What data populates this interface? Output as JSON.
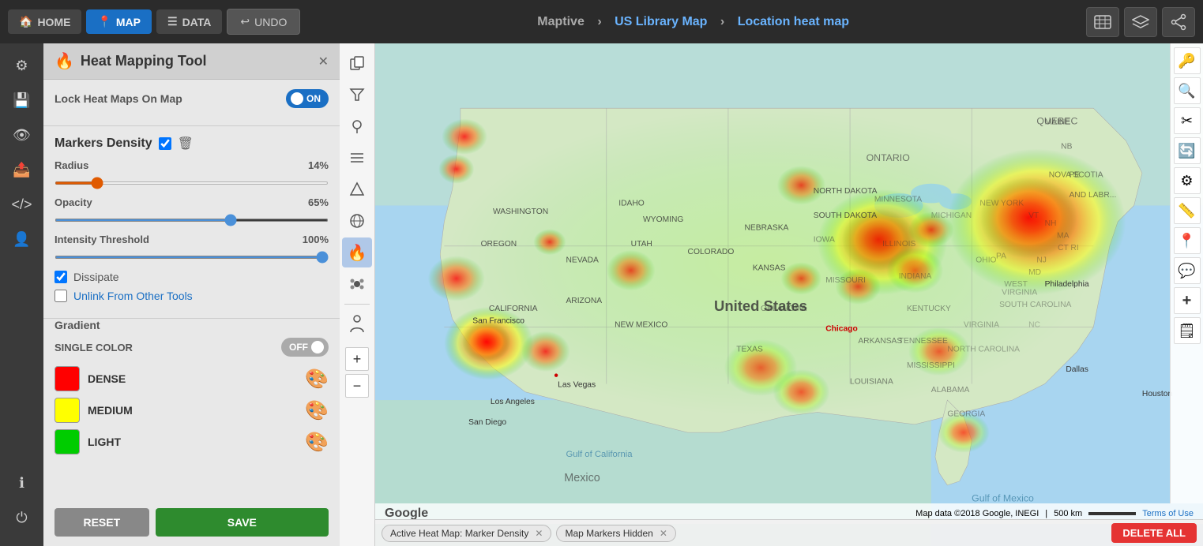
{
  "nav": {
    "home_label": "HOME",
    "map_label": "MAP",
    "data_label": "DATA",
    "undo_label": "UNDO",
    "breadcrumb_brand": "Maptive",
    "breadcrumb_map": "US Library Map",
    "breadcrumb_layer": "Location heat map",
    "map_icon_tooltip": "Map style",
    "layers_icon_tooltip": "Layers",
    "share_icon_tooltip": "Share"
  },
  "left_sidebar": {
    "icons": [
      "⚙",
      "💾",
      "👁",
      "📤",
      "</>",
      "👤",
      "ℹ",
      "⏻"
    ]
  },
  "tool_panel": {
    "title": "Heat Mapping Tool",
    "lock_label": "Lock Heat Maps On Map",
    "toggle_state": "ON",
    "markers_density_label": "Markers Density",
    "radius_label": "Radius",
    "radius_value": "14%",
    "opacity_label": "Opacity",
    "opacity_value": "65%",
    "intensity_label": "Intensity Threshold",
    "intensity_value": "100%",
    "dissipate_label": "Dissipate",
    "unlink_label": "Unlink From Other Tools",
    "gradient_title": "Gradient",
    "single_color_label": "SINGLE COLOR",
    "toggle_off_state": "OFF",
    "dense_label": "DENSE",
    "medium_label": "MEDIUM",
    "light_label": "LIGHT",
    "dense_color": "#ff0000",
    "medium_color": "#ffff00",
    "light_color": "#00cc00",
    "reset_label": "RESET",
    "save_label": "SAVE"
  },
  "map_toolbar": {
    "icons": [
      "copy",
      "filter",
      "pin",
      "layers",
      "shape",
      "globe",
      "fire",
      "cluster"
    ]
  },
  "map": {
    "bottom_left": "Google",
    "map_data": "Map data ©2018 Google, INEGI",
    "scale": "500 km",
    "terms": "Terms of Use"
  },
  "status_bar": {
    "badge1": "Active Heat Map: Marker Density",
    "badge2": "Map Markers Hidden",
    "delete_all": "DELETE ALL"
  },
  "right_sidebar": {
    "icons": [
      "🔑",
      "🔍",
      "✂",
      "🔄",
      "⚙",
      "📏",
      "📍",
      "💬",
      "➕",
      "🗒"
    ]
  }
}
